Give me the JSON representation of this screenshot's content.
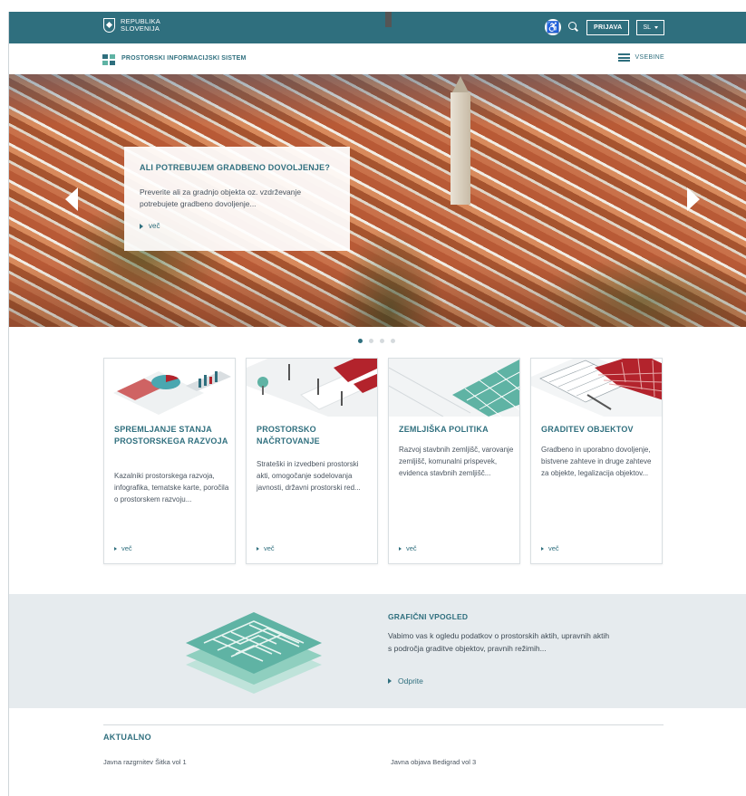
{
  "topbar": {
    "brand_line1": "Republika",
    "brand_line2": "Slovenija",
    "login_label": "PRIJAVA",
    "language": "SL"
  },
  "subbar": {
    "site_title": "PROSTORSKI INFORMACIJSKI SISTEM",
    "menu_label": "VSEBINE"
  },
  "hero": {
    "title": "ALI POTREBUJEM GRADBENO DOVOLJENJE?",
    "text": "Preverite ali za gradnjo objekta oz. vzdrževanje potrebujete gradbeno dovoljenje...",
    "more": "več",
    "slides": 4,
    "active_slide": 1
  },
  "cards": [
    {
      "title": "SPREMLJANJE STANJA PROSTORSKEGA RAZVOJA",
      "text": "Kazalniki prostorskega razvoja, infografika, tematske karte, poročila o prostorskem razvoju...",
      "more": "več"
    },
    {
      "title": "PROSTORSKO NAČRTOVANJE",
      "text": "Strateški in izvedbeni prostorski akti, omogočanje sodelovanja javnosti, državni prostorski red...",
      "more": "več"
    },
    {
      "title": "ZEMLJIŠKA POLITIKA",
      "text": "Razvoj stavbnih zemljišč, varovanje zemljišč, komunalni prispevek, evidenca stavbnih zemljišč...",
      "more": "več"
    },
    {
      "title": "GRADITEV OBJEKTOV",
      "text": "Gradbeno in uporabno dovoljenje, bistvene zahteve in druge zahteve za objekte, legalizacija objektov...",
      "more": "več"
    }
  ],
  "band": {
    "title": "GRAFIČNI VPOGLED",
    "text": "Vabimo vas k ogledu podatkov o prostorskih aktih, upravnih aktih s področja graditve objektov, pravnih režimih...",
    "more": "Odprite"
  },
  "news": {
    "title": "AKTUALNO",
    "items": [
      "Javna razgrnitev Šitka vol 1",
      "Javna objava Bedigrad vol 3"
    ]
  },
  "colors": {
    "primary": "#2f6f7e",
    "accent_red": "#b3232c",
    "accent_teal": "#5fb3a4"
  }
}
